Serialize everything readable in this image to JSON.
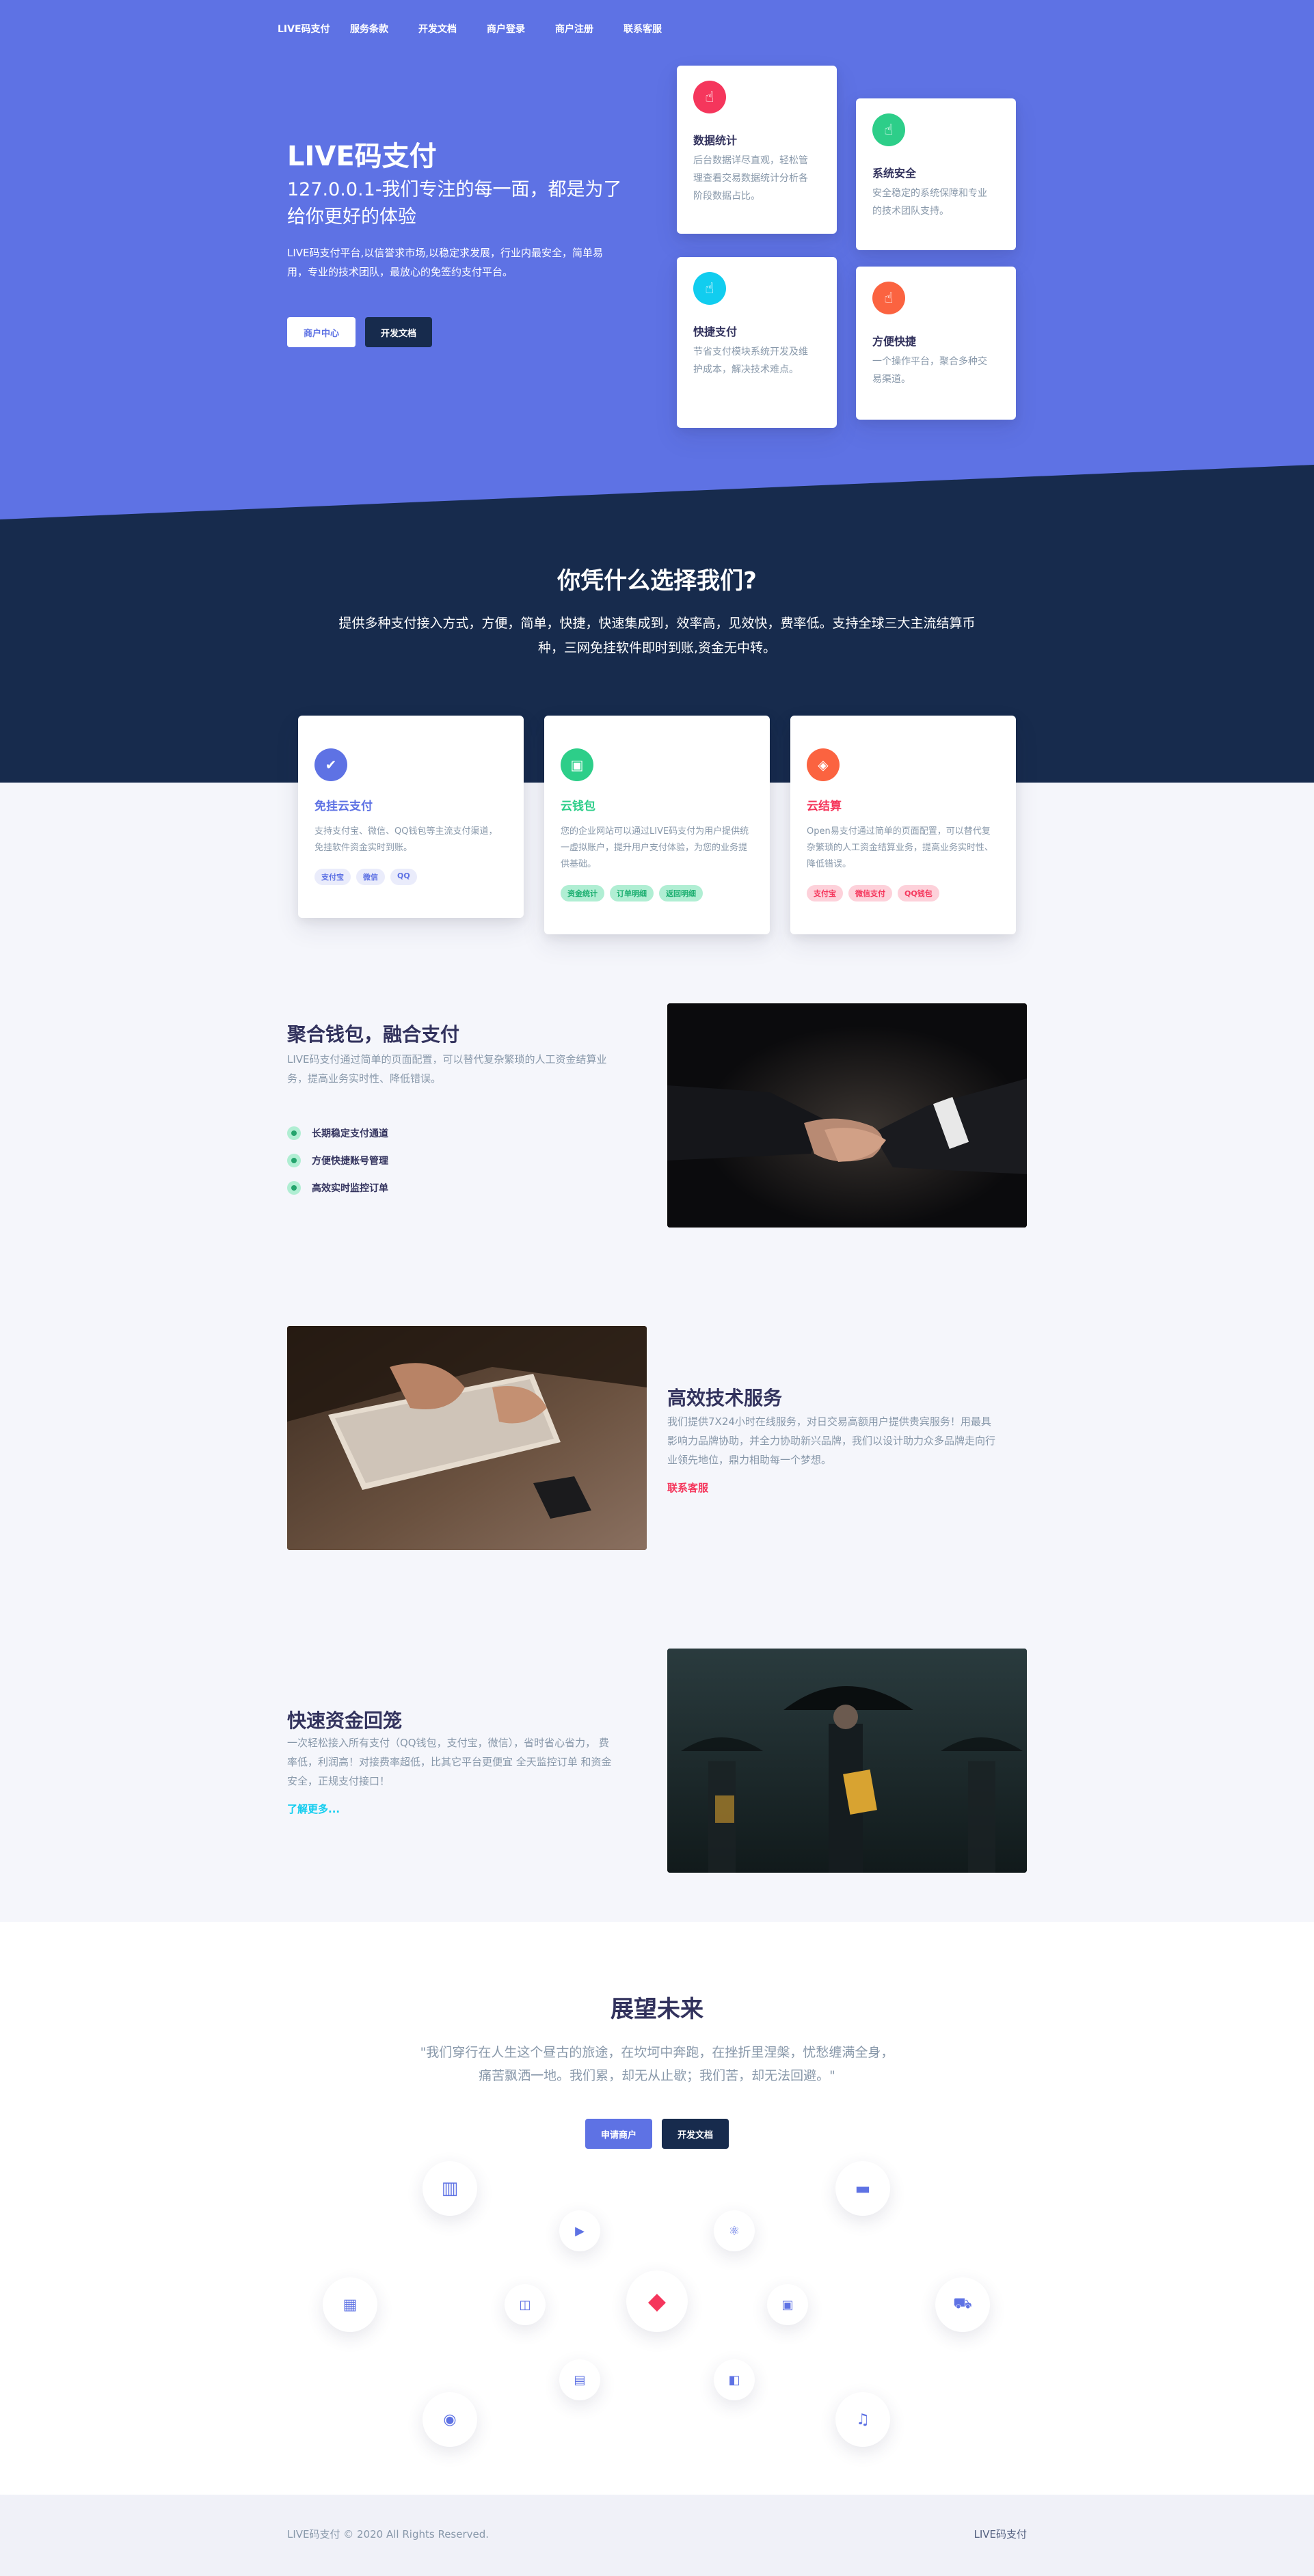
{
  "nav": {
    "brand": "LIVE码支付",
    "items": [
      "服务条款",
      "开发文档",
      "商户登录",
      "商户注册",
      "联系客服"
    ]
  },
  "hero": {
    "title": "LIVE码支付",
    "subtitle": "127.0.0.1-我们专注的每一面，都是为了给你更好的体验",
    "desc": "LIVE码支付平台,以信誉求市场,以稳定求发展，行业内最安全，简单易用，专业的技术团队，最放心的免签约支付平台。",
    "btn_primary": "商户中心",
    "btn_secondary": "开发文档"
  },
  "features": [
    {
      "title": "数据统计",
      "desc": "后台数据详尽直观，轻松管理查看交易数据统计分析各阶段数据占比。",
      "color": "#f5365c",
      "icon": "hand-point-icon"
    },
    {
      "title": "系统安全",
      "desc": "安全稳定的系统保障和专业的技术团队支持。",
      "color": "#2dce89",
      "icon": "hand-point-icon"
    },
    {
      "title": "快捷支付",
      "desc": "节省支付模块系统开发及维护成本，解决技术难点。",
      "color": "#11cdef",
      "icon": "hand-point-icon"
    },
    {
      "title": "方便快捷",
      "desc": "一个操作平台，聚合多种交易渠道。",
      "color": "#fb6340",
      "icon": "hand-point-icon"
    }
  ],
  "why": {
    "title": "你凭什么选择我们?",
    "desc": "提供多种支付接入方式，方便，简单，快捷，快速集成到，效率高，见效快，费率低。支持全球三大主流结算币种，三网免挂软件即时到账,资金无中转。"
  },
  "products": [
    {
      "title": "免挂云支付",
      "desc": "支持支付宝、微信、QQ钱包等主流支付渠道，免挂软件资金实时到账。",
      "color": "#5e72e4",
      "tag_bg": "#eaecfb",
      "tags": [
        "支付宝",
        "微信",
        "QQ"
      ],
      "icon": "check-icon"
    },
    {
      "title": "云钱包",
      "desc": "您的企业网站可以通过LIVE码支付为用户提供统一虚拟账户，提升用户支付体验，为您的业务提供基础。",
      "color": "#2dce89",
      "tag_bg": "#b0eed3",
      "tags": [
        "资金统计",
        "订单明细",
        "返回明细"
      ],
      "icon": "wallet-icon"
    },
    {
      "title": "云结算",
      "desc": "Open易支付通过简单的页面配置，可以替代复杂繁琐的人工资金结算业务，提高业务实时性、降低错误。",
      "color": "#f5365c",
      "tag_bg": "#fdd1da",
      "tags": [
        "支付宝",
        "微信支付",
        "QQ钱包"
      ],
      "icon": "tag-icon"
    }
  ],
  "section1": {
    "title": "聚合钱包，融合支付",
    "desc": "LIVE码支付通过简单的页面配置，可以替代复杂繁琐的人工资金结算业务，提高业务实时性、降低错误。",
    "items": [
      "长期稳定支付通道",
      "方便快捷账号管理",
      "高效实时监控订单"
    ]
  },
  "section2": {
    "title": "高效技术服务",
    "desc": "我们提供7X24小时在线服务，对日交易高额用户提供贵宾服务！用最具影响力品牌协助，并全力协助新兴品牌，我们以设计助力众多品牌走向行业领先地位，鼎力相助每一个梦想。",
    "link": "联系客服"
  },
  "section3": {
    "title": "快速资金回笼",
    "desc": "一次轻松接入所有支付（QQ钱包，支付宝，微信），省时省心省力， 费率低，利润高！对接费率超低，比其它平台更便宜 全天监控订单 和资金安全，正规支付接口！",
    "link": "了解更多..."
  },
  "future": {
    "title": "展望未来",
    "quote": "\"我们穿行在人生这个昼古的旅途，在坎坷中奔跑，在挫折里涅槃，忧愁缠满全身，痛苦飘洒一地。我们累，却无从止歇；我们苦，却无法回避。\"",
    "btn_primary": "申请商户",
    "btn_secondary": "开发文档",
    "icons": [
      "bar-chart-icon",
      "credit-card-icon",
      "play-icon",
      "atom-icon",
      "calendar-icon",
      "briefcase-icon",
      "diamond-icon",
      "image-icon",
      "cart-icon",
      "building-icon",
      "box-icon",
      "camera-icon",
      "bell-icon"
    ]
  },
  "footer": {
    "copyright": "LIVE码支付  © 2020 All Rights Reserved.",
    "brand": "LIVE码支付"
  },
  "colors": {
    "primary": "#5e72e4",
    "dark": "#172b4d",
    "success": "#2dce89",
    "danger": "#f5365c",
    "info": "#11cdef",
    "warning": "#fb6340"
  }
}
